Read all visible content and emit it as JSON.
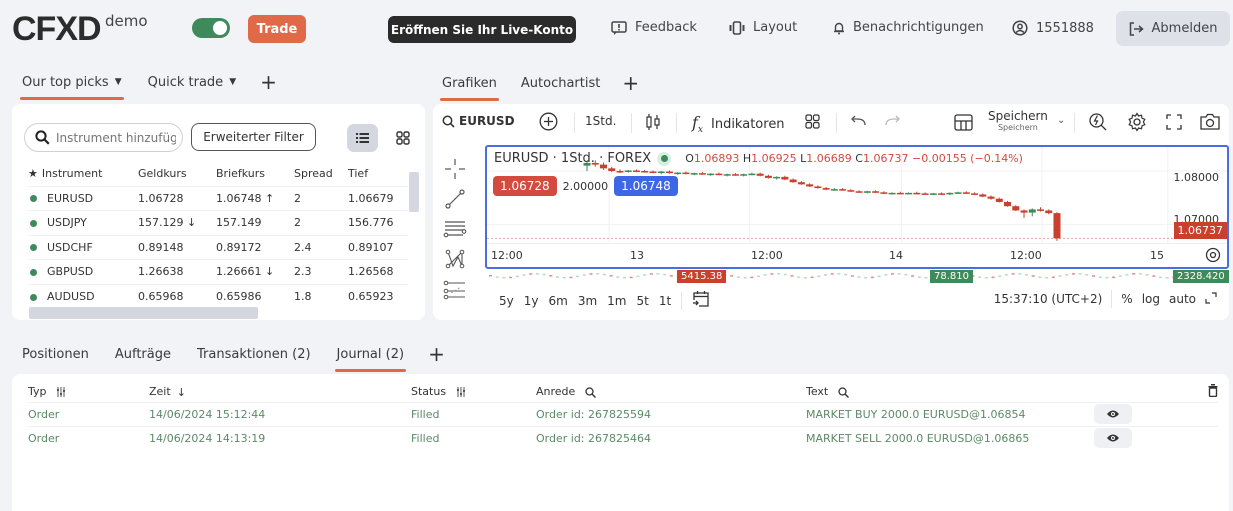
{
  "header": {
    "logo": "CFXD",
    "logo_suffix": "demo",
    "mode_toggle_on": true,
    "trade_label": "Trade",
    "live_account_label": "Eröffnen Sie Ihr Live-Konto",
    "feedback_label": "Feedback",
    "layout_label": "Layout",
    "notifications_label": "Benachrichtigungen",
    "account_id": "1551888",
    "logout_label": "Abmelden"
  },
  "left_tabs": [
    {
      "label": "Our top picks",
      "active": true
    },
    {
      "label": "Quick trade",
      "active": false
    }
  ],
  "chart_tabs": [
    {
      "label": "Grafiken",
      "active": true
    },
    {
      "label": "Autochartist",
      "active": false
    }
  ],
  "add_tab_symbol": "+",
  "watchlist": {
    "search_placeholder": "Instrument hinzufügen",
    "filter_label": "Erweiterter Filter",
    "columns": [
      "Instrument",
      "Geldkurs",
      "Briefkurs",
      "Spread",
      "Tief"
    ],
    "rows": [
      {
        "instrument": "EURUSD",
        "bid": "1.06728",
        "bid_dir": "",
        "ask": "1.06748",
        "ask_dir": "up",
        "spread": "2",
        "low": "1.06679"
      },
      {
        "instrument": "USDJPY",
        "bid": "157.129",
        "bid_dir": "down",
        "ask": "157.149",
        "ask_dir": "",
        "spread": "2",
        "low": "156.776"
      },
      {
        "instrument": "USDCHF",
        "bid": "0.89148",
        "bid_dir": "",
        "ask": "0.89172",
        "ask_dir": "",
        "spread": "2.4",
        "low": "0.89107"
      },
      {
        "instrument": "GBPUSD",
        "bid": "1.26638",
        "bid_dir": "",
        "ask": "1.26661",
        "ask_dir": "down",
        "spread": "2.3",
        "low": "1.26568"
      },
      {
        "instrument": "AUDUSD",
        "bid": "0.65968",
        "bid_dir": "",
        "ask": "0.65986",
        "ask_dir": "",
        "spread": "1.8",
        "low": "0.65923"
      }
    ]
  },
  "chart": {
    "symbol": "EURUSD",
    "interval": "1Std.",
    "indicators_label": "Indikatoren",
    "save_label": "Speichern",
    "save_sublabel": "Speichern",
    "legend_title": "EURUSD · 1Std. · FOREX",
    "ohlc": {
      "o": "1.06893",
      "h": "1.06925",
      "l": "1.06689",
      "c": "1.06737",
      "change": "−0.00155 (−0.14%)"
    },
    "sell_price": "1.06728",
    "spread": "2.00000",
    "buy_price": "1.06748",
    "last_price": "1.06737",
    "y_ticks": [
      "1.08000",
      "1.07000"
    ],
    "x_ticks": [
      "12:00",
      "13",
      "12:00",
      "14",
      "12:00",
      "15"
    ],
    "mini_tickers": [
      {
        "value": "5415.38",
        "color": "#c9402e"
      },
      {
        "value": "78.810",
        "color": "#3f8a5a"
      },
      {
        "value": "2328.420",
        "color": "#3f8a5a"
      }
    ],
    "ranges": [
      "5y",
      "1y",
      "6m",
      "3m",
      "1m",
      "5t",
      "1t"
    ],
    "clock": "15:37:10 (UTC+2)",
    "scale_options": [
      "%",
      "log",
      "auto"
    ],
    "candles": [
      [
        1.081,
        1.0818,
        1.08,
        1.0815
      ],
      [
        1.0815,
        1.082,
        1.0808,
        1.0812
      ],
      [
        1.0812,
        1.0816,
        1.0802,
        1.0805
      ],
      [
        1.0805,
        1.0808,
        1.0798,
        1.08
      ],
      [
        1.08,
        1.0803,
        1.0796,
        1.0799
      ],
      [
        1.0799,
        1.0802,
        1.0797,
        1.0801
      ],
      [
        1.0801,
        1.0803,
        1.0798,
        1.08
      ],
      [
        1.08,
        1.0802,
        1.0797,
        1.0799
      ],
      [
        1.0799,
        1.0801,
        1.0796,
        1.0797
      ],
      [
        1.0797,
        1.08,
        1.0794,
        1.0799
      ],
      [
        1.0799,
        1.0801,
        1.0795,
        1.0796
      ],
      [
        1.0796,
        1.0798,
        1.0793,
        1.0797
      ],
      [
        1.0797,
        1.0799,
        1.0794,
        1.0795
      ],
      [
        1.0795,
        1.0797,
        1.0792,
        1.0796
      ],
      [
        1.0796,
        1.0798,
        1.0793,
        1.0794
      ],
      [
        1.0794,
        1.0796,
        1.0791,
        1.0795
      ],
      [
        1.0795,
        1.0797,
        1.0792,
        1.0793
      ],
      [
        1.0793,
        1.0795,
        1.079,
        1.0794
      ],
      [
        1.0794,
        1.0796,
        1.0791,
        1.0792
      ],
      [
        1.0792,
        1.0795,
        1.079,
        1.0794
      ],
      [
        1.0794,
        1.0797,
        1.0792,
        1.0795
      ],
      [
        1.0795,
        1.0797,
        1.079,
        1.0791
      ],
      [
        1.0791,
        1.0793,
        1.0786,
        1.0787
      ],
      [
        1.0787,
        1.079,
        1.0784,
        1.0789
      ],
      [
        1.0789,
        1.0791,
        1.0783,
        1.0784
      ],
      [
        1.0784,
        1.0786,
        1.0778,
        1.0779
      ],
      [
        1.0779,
        1.0781,
        1.0774,
        1.0775
      ],
      [
        1.0775,
        1.0777,
        1.077,
        1.0771
      ],
      [
        1.0771,
        1.0773,
        1.0767,
        1.0768
      ],
      [
        1.0768,
        1.077,
        1.0764,
        1.0765
      ],
      [
        1.0765,
        1.0768,
        1.0763,
        1.0766
      ],
      [
        1.0766,
        1.0768,
        1.0763,
        1.0764
      ],
      [
        1.0764,
        1.0766,
        1.0761,
        1.0762
      ],
      [
        1.0762,
        1.0764,
        1.0759,
        1.076
      ],
      [
        1.076,
        1.0763,
        1.0758,
        1.0762
      ],
      [
        1.0762,
        1.0764,
        1.0759,
        1.076
      ],
      [
        1.076,
        1.0762,
        1.0757,
        1.0758
      ],
      [
        1.0758,
        1.076,
        1.0756,
        1.0759
      ],
      [
        1.0759,
        1.0761,
        1.0757,
        1.0758
      ],
      [
        1.0758,
        1.076,
        1.0756,
        1.0759
      ],
      [
        1.0759,
        1.0761,
        1.0757,
        1.0758
      ],
      [
        1.0758,
        1.076,
        1.0756,
        1.0757
      ],
      [
        1.0757,
        1.0759,
        1.0755,
        1.0758
      ],
      [
        1.0758,
        1.076,
        1.0756,
        1.0757
      ],
      [
        1.0757,
        1.076,
        1.0755,
        1.0759
      ],
      [
        1.0759,
        1.0761,
        1.0757,
        1.076
      ],
      [
        1.076,
        1.0762,
        1.0757,
        1.0758
      ],
      [
        1.0758,
        1.076,
        1.0755,
        1.0756
      ],
      [
        1.0756,
        1.0758,
        1.0751,
        1.0752
      ],
      [
        1.0752,
        1.0754,
        1.0746,
        1.0748
      ],
      [
        1.0748,
        1.075,
        1.0741,
        1.0742
      ],
      [
        1.0742,
        1.0744,
        1.0733,
        1.0734
      ],
      [
        1.0734,
        1.0736,
        1.0725,
        1.0726
      ],
      [
        1.0726,
        1.0728,
        1.0712,
        1.0722
      ],
      [
        1.0722,
        1.073,
        1.0715,
        1.0728
      ],
      [
        1.0728,
        1.0732,
        1.0724,
        1.0726
      ],
      [
        1.0726,
        1.0728,
        1.0719,
        1.0721
      ],
      [
        1.0721,
        1.0723,
        1.0669,
        1.06737
      ]
    ]
  },
  "bottom_tabs": [
    {
      "label": "Positionen",
      "active": false
    },
    {
      "label": "Aufträge",
      "active": false
    },
    {
      "label": "Transaktionen (2)",
      "active": false
    },
    {
      "label": "Journal (2)",
      "active": true
    }
  ],
  "journal": {
    "columns": [
      "Typ",
      "Zeit",
      "Status",
      "Anrede",
      "Text"
    ],
    "rows": [
      {
        "type": "Order",
        "time": "14/06/2024 15:12:44",
        "status": "Filled",
        "ref": "Order id: 267825594",
        "text": "MARKET BUY 2000.0 EURUSD@1.06854"
      },
      {
        "type": "Order",
        "time": "14/06/2024 14:13:19",
        "status": "Filled",
        "ref": "Order id: 267825464",
        "text": "MARKET SELL 2000.0 EURUSD@1.06865"
      }
    ]
  }
}
